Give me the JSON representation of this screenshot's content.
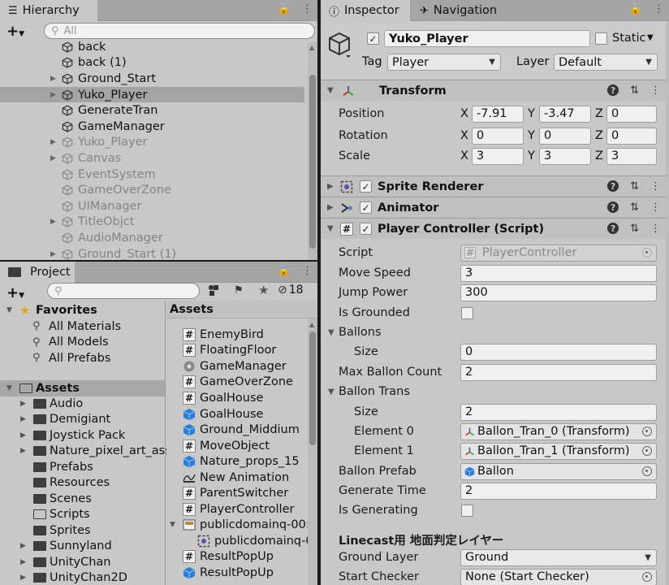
{
  "hierarchy": {
    "tab_label": "Hierarchy",
    "search_placeholder": "All",
    "items": [
      {
        "label": "back",
        "dim": false,
        "expandable": false,
        "selected": false
      },
      {
        "label": "back (1)",
        "dim": false,
        "expandable": false,
        "selected": false
      },
      {
        "label": "Ground_Start",
        "dim": false,
        "expandable": true,
        "selected": false
      },
      {
        "label": "Yuko_Player",
        "dim": false,
        "expandable": true,
        "selected": true
      },
      {
        "label": "GenerateTran",
        "dim": false,
        "expandable": false,
        "selected": false
      },
      {
        "label": "GameManager",
        "dim": false,
        "expandable": false,
        "selected": false
      },
      {
        "label": "Yuko_Player",
        "dim": true,
        "expandable": true,
        "selected": false
      },
      {
        "label": "Canvas",
        "dim": true,
        "expandable": true,
        "selected": false
      },
      {
        "label": "EventSystem",
        "dim": true,
        "expandable": false,
        "selected": false
      },
      {
        "label": "GameOverZone",
        "dim": true,
        "expandable": false,
        "selected": false
      },
      {
        "label": "UIManager",
        "dim": true,
        "expandable": false,
        "selected": false
      },
      {
        "label": "TitleObjct",
        "dim": true,
        "expandable": true,
        "selected": false
      },
      {
        "label": "AudioManager",
        "dim": true,
        "expandable": false,
        "selected": false
      },
      {
        "label": "Ground_Start (1)",
        "dim": true,
        "expandable": true,
        "selected": false
      }
    ]
  },
  "project": {
    "tab_label": "Project",
    "hidden_count": "18",
    "favorites_label": "Favorites",
    "favorites": [
      "All Materials",
      "All Models",
      "All Prefabs"
    ],
    "assets_label": "Assets",
    "folders": [
      {
        "label": "Audio",
        "expandable": true
      },
      {
        "label": "Demigiant",
        "expandable": true
      },
      {
        "label": "Joystick Pack",
        "expandable": true
      },
      {
        "label": "Nature_pixel_art_ass",
        "expandable": true
      },
      {
        "label": "Prefabs",
        "expandable": false
      },
      {
        "label": "Resources",
        "expandable": false
      },
      {
        "label": "Scenes",
        "expandable": false
      },
      {
        "label": "Scripts",
        "expandable": false,
        "open": true
      },
      {
        "label": "Sprites",
        "expandable": false
      },
      {
        "label": "Sunnyland",
        "expandable": true
      },
      {
        "label": "UnityChan",
        "expandable": true
      },
      {
        "label": "UnityChan2D",
        "expandable": true
      }
    ],
    "assets_header": "Assets",
    "assets": [
      {
        "label": "EnemyBird",
        "type": "script"
      },
      {
        "label": "FloatingFloor",
        "type": "script"
      },
      {
        "label": "GameManager",
        "type": "manager"
      },
      {
        "label": "GameOverZone",
        "type": "script"
      },
      {
        "label": "GoalHouse",
        "type": "script"
      },
      {
        "label": "GoalHouse",
        "type": "prefab"
      },
      {
        "label": "Ground_Middium",
        "type": "prefab"
      },
      {
        "label": "MoveObject",
        "type": "script"
      },
      {
        "label": "Nature_props_15",
        "type": "prefab"
      },
      {
        "label": "New Animation",
        "type": "anim"
      },
      {
        "label": "ParentSwitcher",
        "type": "script"
      },
      {
        "label": "PlayerController",
        "type": "script"
      },
      {
        "label": "publicdomainq-00:",
        "type": "image",
        "expandable": true
      },
      {
        "label": "publicdomainq-0",
        "type": "sprite",
        "indent": true
      },
      {
        "label": "ResultPopUp",
        "type": "script"
      },
      {
        "label": "ResultPopUp",
        "type": "prefab"
      }
    ]
  },
  "inspector": {
    "tab_label": "Inspector",
    "nav_tab_label": "Navigation",
    "object_name": "Yuko_Player",
    "static_label": "Static",
    "tag_label": "Tag",
    "tag_value": "Player",
    "layer_label": "Layer",
    "layer_value": "Default",
    "transform": {
      "title": "Transform",
      "position_label": "Position",
      "rotation_label": "Rotation",
      "scale_label": "Scale",
      "position": {
        "x": "-7.91",
        "y": "-3.47",
        "z": "0"
      },
      "rotation": {
        "x": "0",
        "y": "0",
        "z": "0"
      },
      "scale": {
        "x": "3",
        "y": "3",
        "z": "3"
      }
    },
    "sprite_renderer_title": "Sprite Renderer",
    "animator_title": "Animator",
    "player_controller": {
      "title": "Player Controller (Script)",
      "script_label": "Script",
      "script_value": "PlayerController",
      "move_speed_label": "Move Speed",
      "move_speed": "3",
      "jump_power_label": "Jump Power",
      "jump_power": "300",
      "is_grounded_label": "Is Grounded",
      "ballons_label": "Ballons",
      "ballons_size_label": "Size",
      "ballons_size": "0",
      "max_ballon_count_label": "Max Ballon Count",
      "max_ballon_count": "2",
      "ballon_trans_label": "Ballon Trans",
      "ballon_trans_size_label": "Size",
      "ballon_trans_size": "2",
      "element0_label": "Element 0",
      "element0_value": "Ballon_Tran_0 (Transform)",
      "element1_label": "Element 1",
      "element1_value": "Ballon_Tran_1 (Transform)",
      "ballon_prefab_label": "Ballon Prefab",
      "ballon_prefab_value": "Ballon",
      "generate_time_label": "Generate Time",
      "generate_time": "2",
      "is_generating_label": "Is Generating",
      "linecast_header": "Linecast用 地面判定レイヤー",
      "ground_layer_label": "Ground Layer",
      "ground_layer_value": "Ground",
      "start_checker_label": "Start Checker",
      "start_checker_value": "None (Start Checker)"
    },
    "axis_x": "X",
    "axis_y": "Y",
    "axis_z": "Z"
  }
}
